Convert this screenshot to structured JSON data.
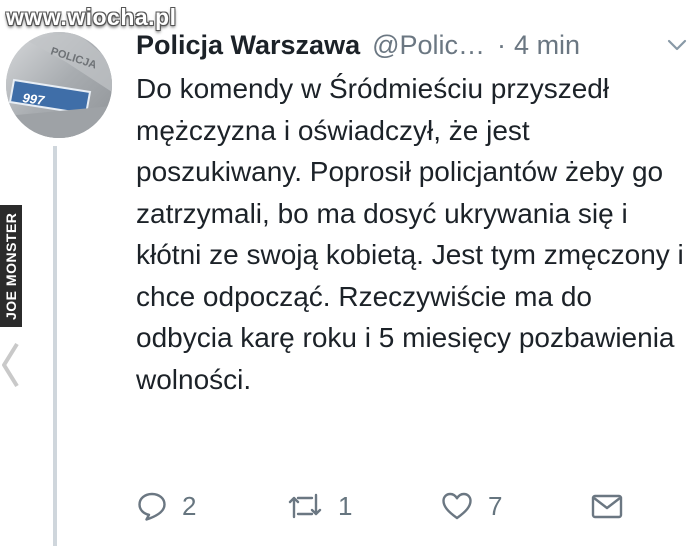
{
  "watermark": "www.wiocha.pl",
  "side_banner": "JOE MONSTER",
  "avatar": {
    "badge_text": "997",
    "seal_text": "POLICJA"
  },
  "tweet": {
    "author_name": "Policja Warszawa",
    "handle": "@Polic…",
    "separator": "·",
    "time": "4 min",
    "text": "Do komendy w Śródmieściu przyszedł mężczyzna i oświadczył, że jest poszukiwany. Poprosił policjantów żeby go zatrzymali, bo ma dosyć ukrywania się i kłótni ze swoją kobietą. Jest tym zmęczony i chce odpocząć. Rzeczywiście ma do odbycia karę roku i 5 miesięcy pozbawienia wolności."
  },
  "actions": {
    "reply_count": "2",
    "retweet_count": "1",
    "like_count": "7"
  },
  "icons": [
    "chevron-left-icon",
    "chevron-down-icon",
    "reply-icon",
    "retweet-icon",
    "like-icon",
    "message-icon"
  ],
  "colors": {
    "text": "#1c2228",
    "secondary": "#6b7782",
    "thread_line": "#cfd6dc"
  }
}
